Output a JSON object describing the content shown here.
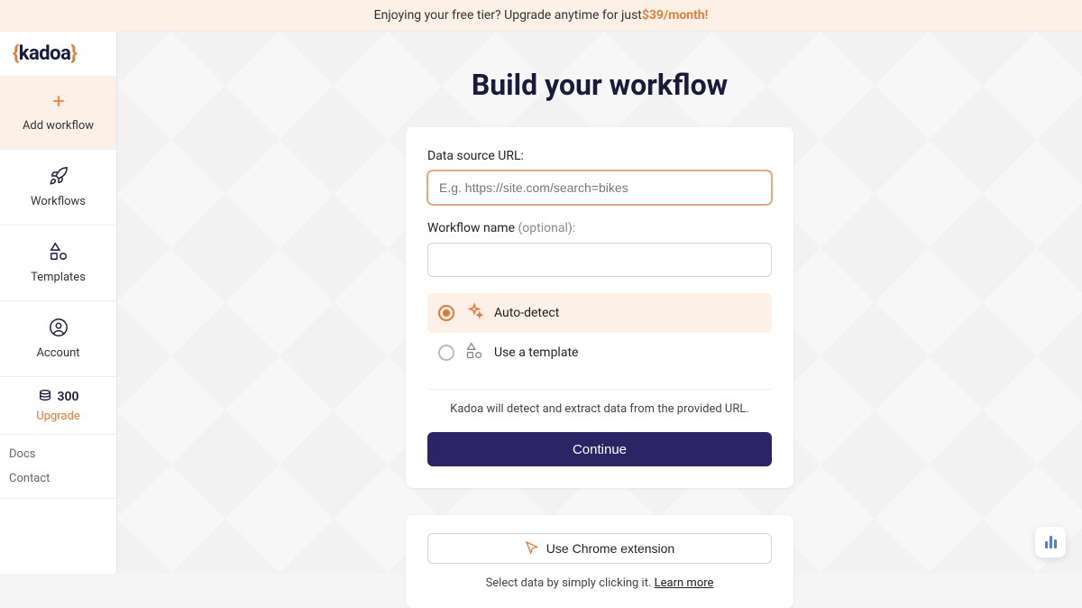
{
  "banner": {
    "text": "Enjoying your free tier? Upgrade anytime for just ",
    "price": "$39/month!"
  },
  "logo": {
    "open": "{",
    "name": "kadoa",
    "close": "}"
  },
  "sidebar": {
    "items": [
      {
        "label": "Add workflow"
      },
      {
        "label": "Workflows"
      },
      {
        "label": "Templates"
      },
      {
        "label": "Account"
      }
    ],
    "credits": "300",
    "upgrade": "Upgrade",
    "footer": [
      "Docs",
      "Contact"
    ]
  },
  "page": {
    "title": "Build your workflow",
    "url_label": "Data source URL:",
    "url_placeholder": "E.g. https://site.com/search=bikes",
    "name_label": "Workflow name ",
    "name_label_muted": "(optional):",
    "options": [
      {
        "label": "Auto-detect"
      },
      {
        "label": "Use a template"
      }
    ],
    "hint": "Kadoa will detect and extract data from the provided URL.",
    "continue": "Continue",
    "ext_button": "Use Chrome extension",
    "ext_hint": "Select data by simply clicking it. ",
    "ext_link": "Learn more"
  }
}
